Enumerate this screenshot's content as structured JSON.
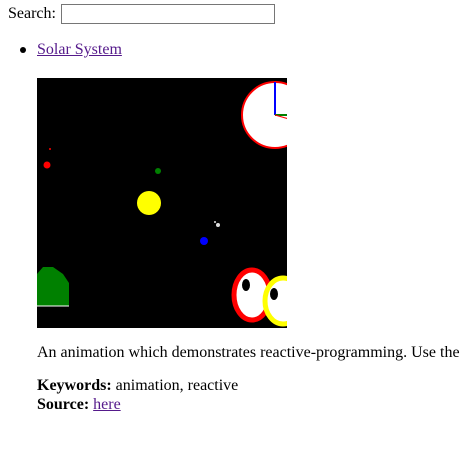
{
  "search": {
    "label": "Search:",
    "value": "",
    "placeholder": ""
  },
  "entry": {
    "title": "Solar System",
    "description": "An animation which demonstrates reactive-programming. Use the",
    "keywords_label": "Keywords:",
    "keywords": "animation, reactive",
    "source_label": "Source:",
    "source_link": "here"
  },
  "colors": {
    "link": "#551a8b",
    "canvas_bg": "#000000",
    "sun": "#ffff00",
    "planet_red": "#ff0000",
    "planet_green": "#008000",
    "planet_blue": "#0000ff",
    "clock_face": "#ffffff",
    "clock_rim": "#ff0000"
  }
}
